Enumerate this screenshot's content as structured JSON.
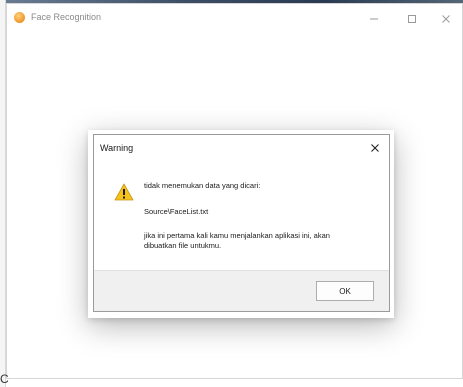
{
  "window": {
    "title": "Face Recognition",
    "icon": "app-flame-icon"
  },
  "dialog": {
    "title": "Warning",
    "icon": "warning-icon",
    "message_line1": "tidak menemukan data yang dicari:",
    "message_path": "Source\\FaceList.txt",
    "message_info": "jika ini pertama kali kamu menjalankan aplikasi ini, akan dibuatkan file untukmu.",
    "ok_label": "OK"
  },
  "corner_text": "C"
}
